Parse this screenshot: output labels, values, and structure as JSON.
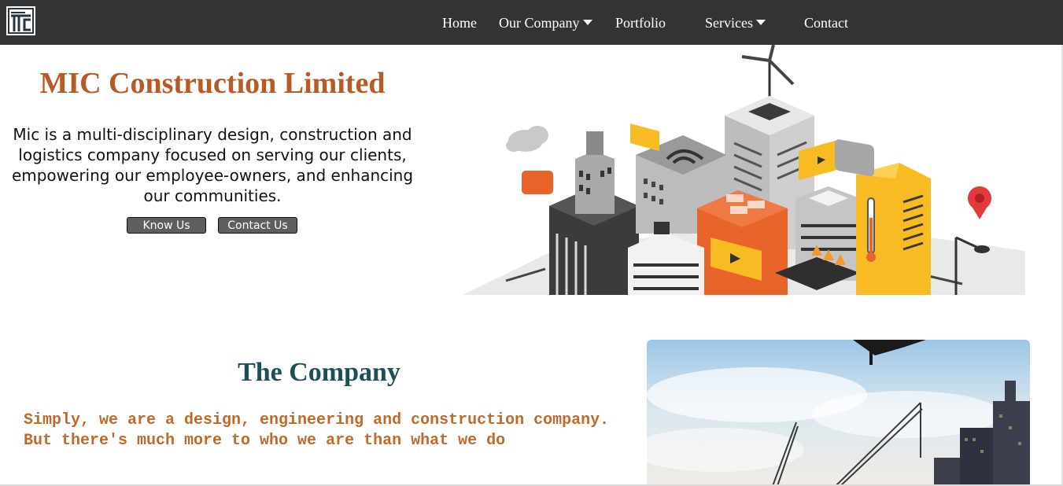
{
  "brand": {
    "logo_alt": "MIC logo"
  },
  "nav": {
    "items": [
      {
        "label": "Home"
      },
      {
        "label": "Our Company"
      },
      {
        "label": "Portfolio"
      },
      {
        "label": "Services"
      },
      {
        "label": "Contact"
      }
    ]
  },
  "hero": {
    "title": "MIC Construction Limited",
    "description": "Mic is a multi-disciplinary design, construction and logistics company focused on serving our clients, empowering our employee-owners, and enhancing our communities.",
    "know_us_label": "Know Us",
    "contact_us_label": "Contact Us"
  },
  "company": {
    "title": "The Company",
    "text": "Simply, we are a design, engineering and construction company. But there's much more to who we are than what we do"
  },
  "colors": {
    "navbar": "#333333",
    "hero_title": "#b85a25",
    "company_title": "#1d4f56",
    "company_text": "#c0692a",
    "button": "#5e5e5e",
    "accent_orange": "#e8642b",
    "accent_yellow": "#f9bb23"
  }
}
